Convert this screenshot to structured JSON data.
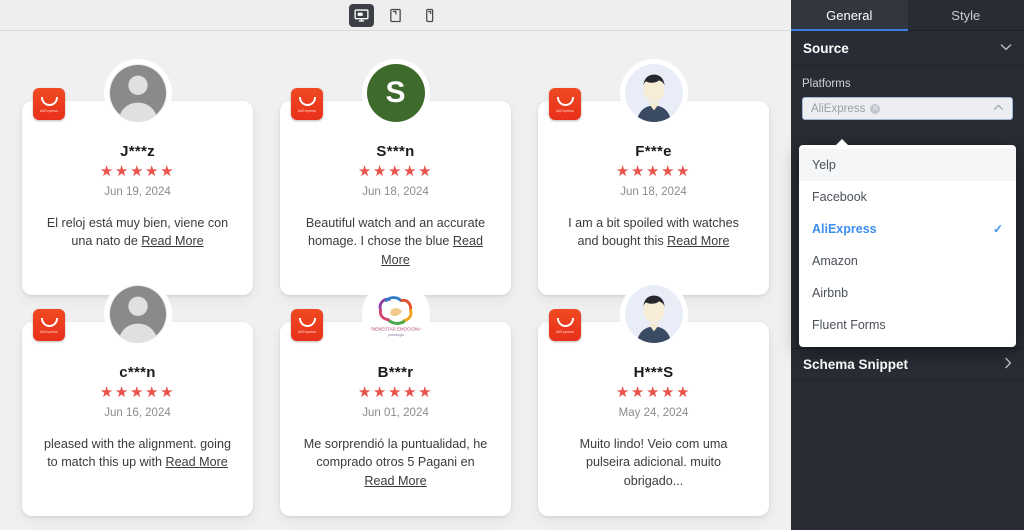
{
  "toolbar": {
    "devices": [
      {
        "name": "desktop",
        "icon": "desktop-icon",
        "active": true
      },
      {
        "name": "tablet",
        "icon": "tablet-icon",
        "active": false
      },
      {
        "name": "mobile",
        "icon": "mobile-icon",
        "active": false
      }
    ]
  },
  "reviews": [
    {
      "platform_badge": "AliExpress",
      "avatar": {
        "type": "silhouette",
        "bg": "#8a8a8a"
      },
      "name": "J***z",
      "stars": "★★★★★",
      "rating": 5,
      "date": "Jun 19, 2024",
      "text": "El reloj está muy bien, viene con una nato de ",
      "read_more": "Read More"
    },
    {
      "platform_badge": "AliExpress",
      "avatar": {
        "type": "initial",
        "letter": "S",
        "bg": "#3e6b2b"
      },
      "name": "S***n",
      "stars": "★★★★★",
      "rating": 5,
      "date": "Jun 18, 2024",
      "text": "Beautiful watch and an accurate homage. I chose the blue ",
      "read_more": "Read More"
    },
    {
      "platform_badge": "AliExpress",
      "avatar": {
        "type": "person",
        "bg": "#e8edf8"
      },
      "name": "F***e",
      "stars": "★★★★★",
      "rating": 5,
      "date": "Jun 18, 2024",
      "text": "I am a bit spoiled with watches and bought this ",
      "read_more": "Read More"
    },
    {
      "platform_badge": "AliExpress",
      "avatar": {
        "type": "silhouette",
        "bg": "#8a8a8a"
      },
      "name": "c***n",
      "stars": "★★★★★",
      "rating": 5,
      "date": "Jun 16, 2024",
      "text": "pleased with the alignment. going to match this up with ",
      "read_more": "Read More"
    },
    {
      "platform_badge": "AliExpress",
      "avatar": {
        "type": "logo",
        "bg": "#ffffff",
        "logo_title": "BIENESTAR EMOCIONA",
        "logo_sub": "psicologia"
      },
      "name": "B***r",
      "stars": "★★★★★",
      "rating": 5,
      "date": "Jun 01, 2024",
      "text": "Me sorprendió la puntualidad, he comprado otros 5 Pagani en ",
      "read_more": "Read More"
    },
    {
      "platform_badge": "AliExpress",
      "avatar": {
        "type": "person",
        "bg": "#e8edf8"
      },
      "name": "H***S",
      "stars": "★★★★★",
      "rating": 5,
      "date": "May 24, 2024",
      "text": "Muito lindo! Veio com uma pulseira adicional. muito obrigado...",
      "read_more": ""
    }
  ],
  "panel": {
    "tabs": [
      {
        "label": "General",
        "active": true
      },
      {
        "label": "Style",
        "active": false
      }
    ],
    "source_section": {
      "title": "Source",
      "chevron": "chevron-down-icon"
    },
    "platforms_field": {
      "label": "Platforms",
      "selected_chip": "AliExpress",
      "arrow": "chevron-up-icon"
    },
    "dropdown_options": [
      {
        "label": "Yelp",
        "selected": false,
        "hover": true
      },
      {
        "label": "Facebook",
        "selected": false,
        "hover": false
      },
      {
        "label": "AliExpress",
        "selected": true,
        "hover": false
      },
      {
        "label": "Amazon",
        "selected": false,
        "hover": false
      },
      {
        "label": "Airbnb",
        "selected": false,
        "hover": false
      },
      {
        "label": "Fluent Forms",
        "selected": false,
        "hover": false
      }
    ],
    "schema_snippet": {
      "title": "Schema Snippet",
      "chevron": "chevron-right-icon"
    }
  },
  "colors": {
    "accent_blue": "#3c8ef0",
    "star_red": "#e9534b",
    "badge_red": "#e8301a",
    "panel_bg": "#282c34",
    "canvas_bg": "#f0f0f0"
  }
}
